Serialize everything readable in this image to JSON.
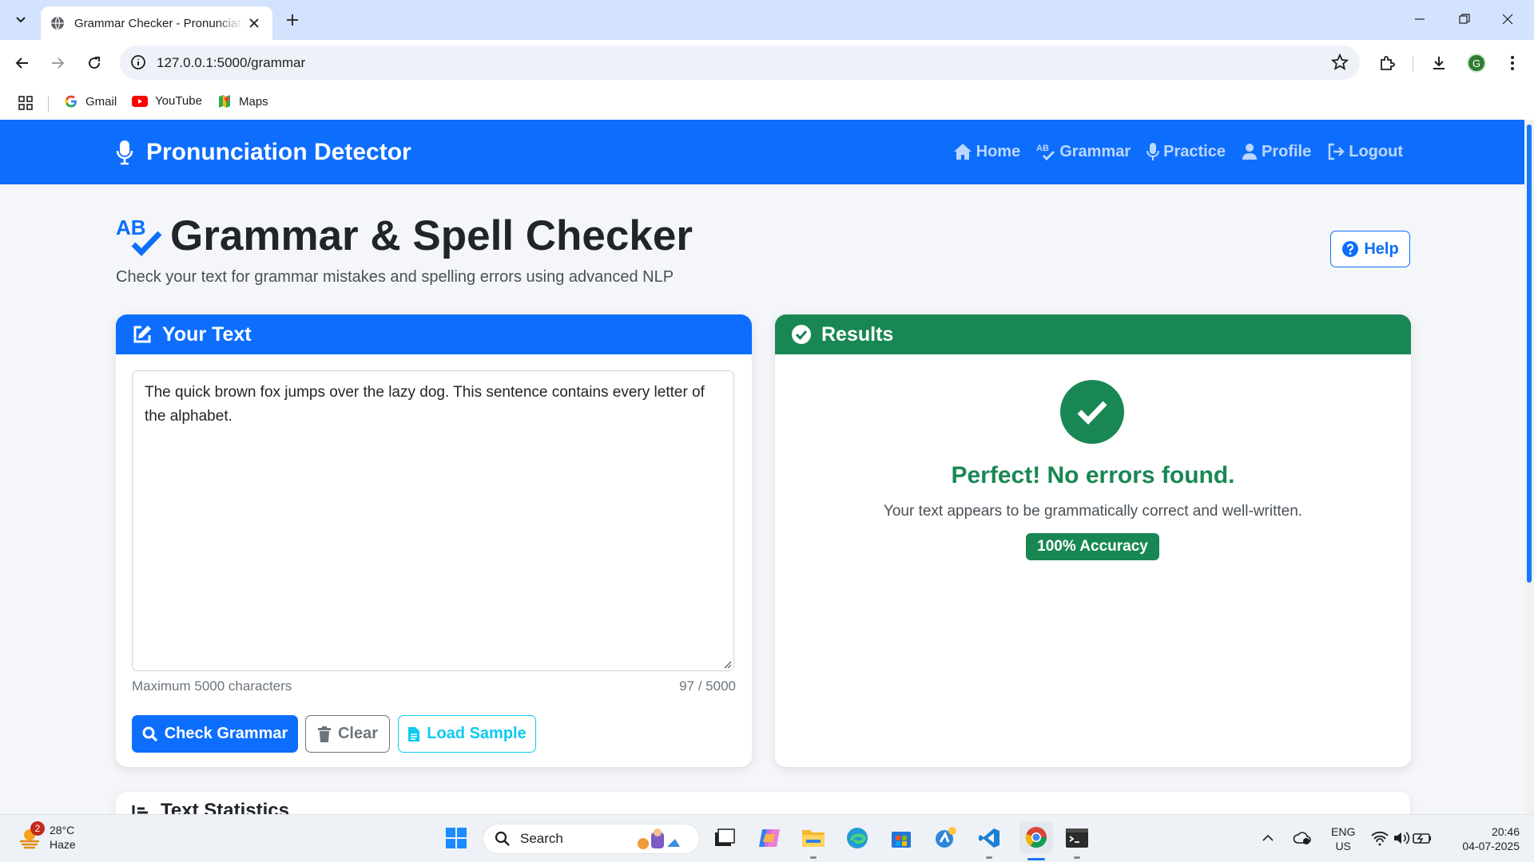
{
  "browser": {
    "tab_title": "Grammar Checker - Pronunciation Detector",
    "url": "127.0.0.1:5000/grammar",
    "profile_initial": "G",
    "bookmarks": [
      "Gmail",
      "YouTube",
      "Maps"
    ]
  },
  "navbar": {
    "brand": "Pronunciation Detector",
    "links": [
      "Home",
      "Grammar",
      "Practice",
      "Profile",
      "Logout"
    ]
  },
  "header": {
    "title": "Grammar & Spell Checker",
    "subtitle": "Check your text for grammar mistakes and spelling errors using advanced NLP",
    "help_label": "Help"
  },
  "input_card": {
    "title": "Your Text",
    "text": "The quick brown fox jumps over the lazy dog. This sentence contains every letter of the alphabet.",
    "hint": "Maximum 5000 characters",
    "counter": "97 / 5000",
    "buttons": {
      "check": "Check Grammar",
      "clear": "Clear",
      "sample": "Load Sample"
    }
  },
  "results_card": {
    "title": "Results",
    "headline": "Perfect! No errors found.",
    "message": "Your text appears to be grammatically correct and well-written.",
    "badge": "100% Accuracy"
  },
  "stats_card": {
    "title": "Text Statistics"
  },
  "taskbar": {
    "weather_temp": "28°C",
    "weather_desc": "Haze",
    "weather_alerts": "2",
    "search_placeholder": "Search",
    "lang_top": "ENG",
    "lang_bottom": "US",
    "time": "20:46",
    "date": "04-07-2025"
  },
  "colors": {
    "primary": "#0d6efd",
    "success": "#198754",
    "info": "#0dcaf0",
    "secondary": "#6c757d"
  }
}
